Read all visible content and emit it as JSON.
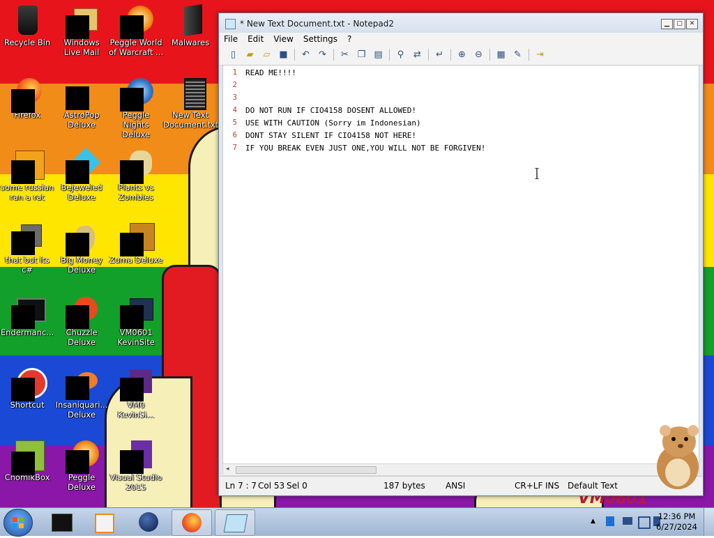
{
  "desktop": {
    "icons": [
      {
        "label": "Recycle Bin"
      },
      {
        "label": "Windows Live Mail"
      },
      {
        "label": "Peggle World of Warcraft ..."
      },
      {
        "label": "Malwares"
      },
      {
        "label": "Firefox"
      },
      {
        "label": "AstroPop Deluxe"
      },
      {
        "label": "Peggle Nights Deluxe"
      },
      {
        "label": "New Text Document.txt"
      },
      {
        "label": "some russian ran a rat"
      },
      {
        "label": "Bejeweled Deluxe"
      },
      {
        "label": "Plants vs Zombies"
      },
      {
        "label": "that but its c#"
      },
      {
        "label": "Big Money Deluxe"
      },
      {
        "label": "Zuma Deluxe"
      },
      {
        "label": "Endermanc..."
      },
      {
        "label": "Chuzzle Deluxe"
      },
      {
        "label": "VM0601 KevinSite"
      },
      {
        "label": "Shortcut"
      },
      {
        "label": "Insaniquari... Deluxe"
      },
      {
        "label": "VM0 KevinSi..."
      },
      {
        "label": "ChomikBox"
      },
      {
        "label": "Peggle Deluxe"
      },
      {
        "label": "Visual Studio 2015"
      }
    ],
    "watermark": "VM0601"
  },
  "notepad": {
    "title": "* New Text Document.txt - Notepad2",
    "menu": [
      "File",
      "Edit",
      "View",
      "Settings",
      "?"
    ],
    "toolbar_icons": [
      "new-icon",
      "open-icon",
      "browse-icon",
      "save-icon",
      "undo-icon",
      "redo-icon",
      "cut-icon",
      "copy-icon",
      "paste-icon",
      "find-icon",
      "replace-icon",
      "word-wrap-icon",
      "zoom-in-icon",
      "zoom-out-icon",
      "select-scheme-icon",
      "customize-scheme-icon",
      "exit-icon"
    ],
    "lines": [
      {
        "num": "1",
        "text": "READ ME!!!!"
      },
      {
        "num": "2",
        "text": ""
      },
      {
        "num": "3",
        "text": ""
      },
      {
        "num": "4",
        "text": "DO NOT RUN IF CIO4158 DOSENT ALLOWED!"
      },
      {
        "num": "5",
        "text": "USE WITH CAUTION (Sorry im Indonesian)"
      },
      {
        "num": "6",
        "text": "DONT STAY SILENT IF CIO4158 NOT HERE!"
      },
      {
        "num": "7",
        "text": "IF YOU BREAK EVEN JUST ONE,YOU WILL NOT BE FORGIVEN!"
      }
    ],
    "status": {
      "position": "Ln 7 : 7",
      "col": "Col 53",
      "sel": "Sel 0",
      "size": "187 bytes",
      "encoding": "ANSI",
      "eol": "CR+LF",
      "mode": "INS",
      "scheme": "Default Text"
    }
  },
  "taskbar": {
    "items": [
      "virtualbox-icon",
      "media-player-icon",
      "globe-icon",
      "firefox-icon",
      "notepad-icon"
    ],
    "clock": {
      "time": "12:36 PM",
      "date": "6/27/2024"
    }
  }
}
